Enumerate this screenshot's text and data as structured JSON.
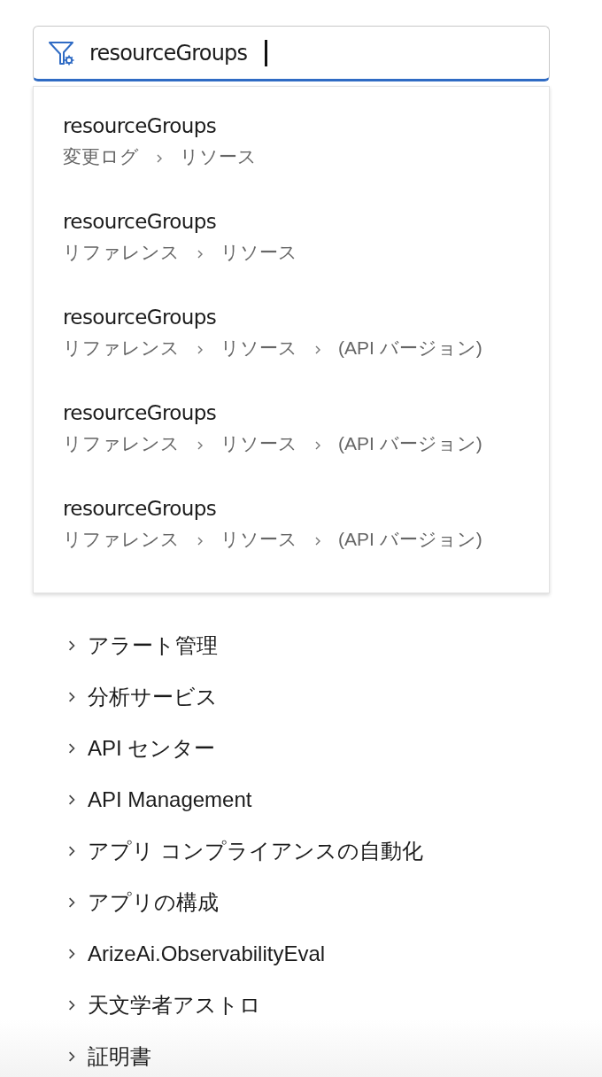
{
  "search": {
    "value": "resourceGroups"
  },
  "suggestions": [
    {
      "title": "resourceGroups",
      "path": [
        "変更ログ",
        "リソース"
      ]
    },
    {
      "title": "resourceGroups",
      "path": [
        "リファレンス",
        "リソース"
      ]
    },
    {
      "title": "resourceGroups",
      "path": [
        "リファレンス",
        "リソース",
        "(API バージョン)"
      ]
    },
    {
      "title": "resourceGroups",
      "path": [
        "リファレンス",
        "リソース",
        "(API バージョン)"
      ]
    },
    {
      "title": "resourceGroups",
      "path": [
        "リファレンス",
        "リソース",
        "(API バージョン)"
      ]
    }
  ],
  "tree": [
    {
      "label": "アラート管理",
      "expanded": false
    },
    {
      "label": "分析サービス",
      "expanded": false
    },
    {
      "label": "API センター",
      "expanded": false
    },
    {
      "label": "API Management",
      "expanded": false
    },
    {
      "label": "アプリ コンプライアンスの自動化",
      "expanded": false
    },
    {
      "label": "アプリの構成",
      "expanded": false
    },
    {
      "label": "ArizeAi.ObservabilityEval",
      "expanded": false
    },
    {
      "label": "天文学者アストロ",
      "expanded": false
    },
    {
      "label": "証明書",
      "expanded": false
    }
  ]
}
